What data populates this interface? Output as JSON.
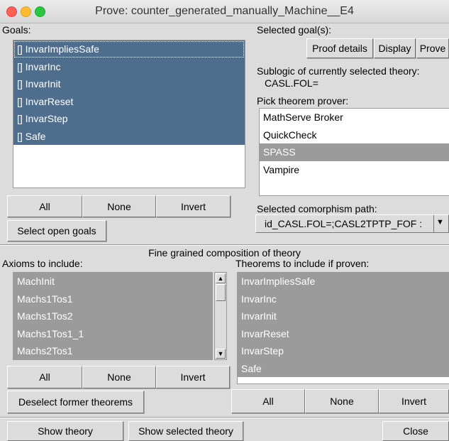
{
  "window": {
    "title": "Prove: counter_generated_manually_Machine__E4"
  },
  "goals": {
    "label": "Goals:",
    "items": [
      "[] InvarImpliesSafe",
      "[] InvarInc",
      "[] InvarInit",
      "[] InvarReset",
      "[] InvarStep",
      "[] Safe"
    ],
    "buttons": {
      "all": "All",
      "none": "None",
      "invert": "Invert",
      "open": "Select open goals"
    }
  },
  "selected": {
    "label": "Selected goal(s):",
    "proof_details": "Proof details",
    "display": "Display",
    "prove": "Prove"
  },
  "sublogic": {
    "label": "Sublogic of currently selected theory:",
    "value": "CASL.FOL="
  },
  "prover": {
    "label": "Pick theorem prover:",
    "items": [
      "MathServe Broker",
      "QuickCheck",
      "SPASS",
      "Vampire"
    ],
    "selected": "SPASS"
  },
  "comorphism": {
    "label": "Selected comorphism path:",
    "value": "id_CASL.FOL=;CASL2TPTP_FOF :"
  },
  "composition": {
    "heading": "Fine grained composition of theory",
    "axioms_label": "Axioms to include:",
    "axioms": [
      "MachInit",
      "Machs1Tos1",
      "Machs1Tos2",
      "Machs1Tos1_1",
      "Machs2Tos1"
    ],
    "theorems_label": "Theorems to include if proven:",
    "theorems": [
      "InvarImpliesSafe",
      "InvarInc",
      "InvarInit",
      "InvarReset",
      "InvarStep",
      "Safe"
    ],
    "axiom_buttons": {
      "all": "All",
      "none": "None",
      "invert": "Invert"
    },
    "deselect": "Deselect former theorems",
    "theorem_buttons": {
      "all": "All",
      "none": "None",
      "invert": "Invert"
    }
  },
  "bottom": {
    "show_theory": "Show theory",
    "show_selected": "Show selected theory",
    "close": "Close"
  },
  "icons": {
    "scroll_up": "▲",
    "scroll_down": "▼",
    "combo_arrow": "▼"
  }
}
